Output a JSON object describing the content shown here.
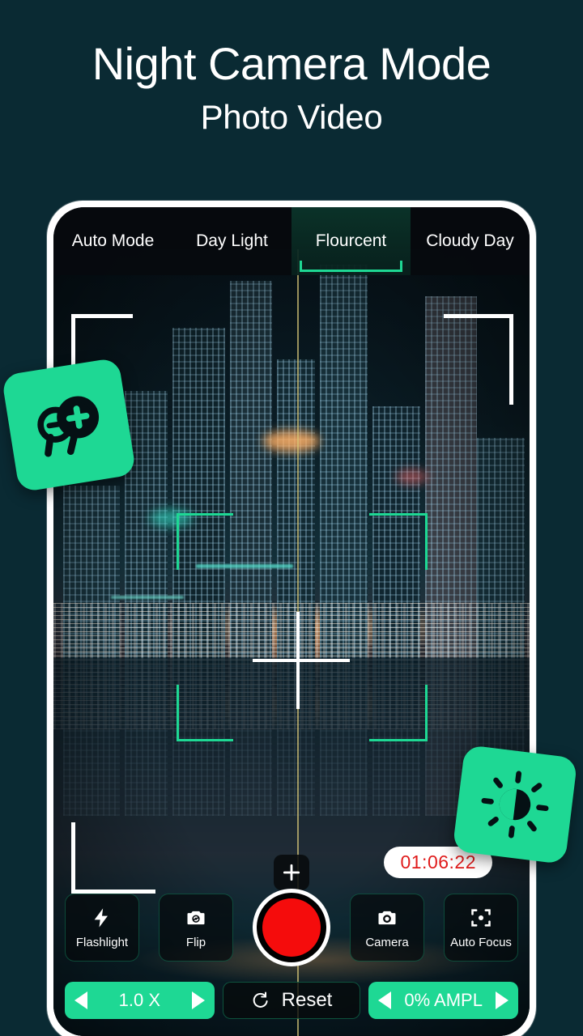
{
  "header": {
    "title": "Night Camera Mode",
    "subtitle": "Photo Video"
  },
  "colors": {
    "background": "#0a2a33",
    "accent_green": "#1ed894",
    "record_red": "#f50c0c",
    "timer_text": "#e01b1b",
    "phone_frame": "#ffffff"
  },
  "camera": {
    "tabs": [
      {
        "label": "Auto Mode",
        "selected": false
      },
      {
        "label": "Day Light",
        "selected": false
      },
      {
        "label": "Flourcent",
        "selected": true
      },
      {
        "label": "Cloudy Day",
        "selected": false
      }
    ],
    "timer": "01:06:22",
    "focus_add_icon": "plus-icon",
    "controls": [
      {
        "label": "Flashlight",
        "icon": "flash-icon"
      },
      {
        "label": "Flip",
        "icon": "camera-flip-icon"
      },
      {
        "label": "Camera",
        "icon": "camera-icon"
      },
      {
        "label": "Auto Focus",
        "icon": "focus-frame-icon"
      }
    ],
    "record_button": "record-button",
    "zoom_stepper": {
      "value": "1.0 X",
      "dec_icon": "arrow-left-icon",
      "inc_icon": "arrow-right-icon"
    },
    "reset_button": {
      "label": "Reset",
      "icon": "refresh-icon"
    },
    "ampl_stepper": {
      "value": "0% AMPL",
      "dec_icon": "arrow-left-icon",
      "inc_icon": "arrow-right-icon"
    }
  },
  "badges": [
    {
      "name": "zoom-in-out-badge",
      "icon": "magnifier-plus-minus-icon"
    },
    {
      "name": "brightness-badge",
      "icon": "brightness-sun-icon"
    }
  ]
}
